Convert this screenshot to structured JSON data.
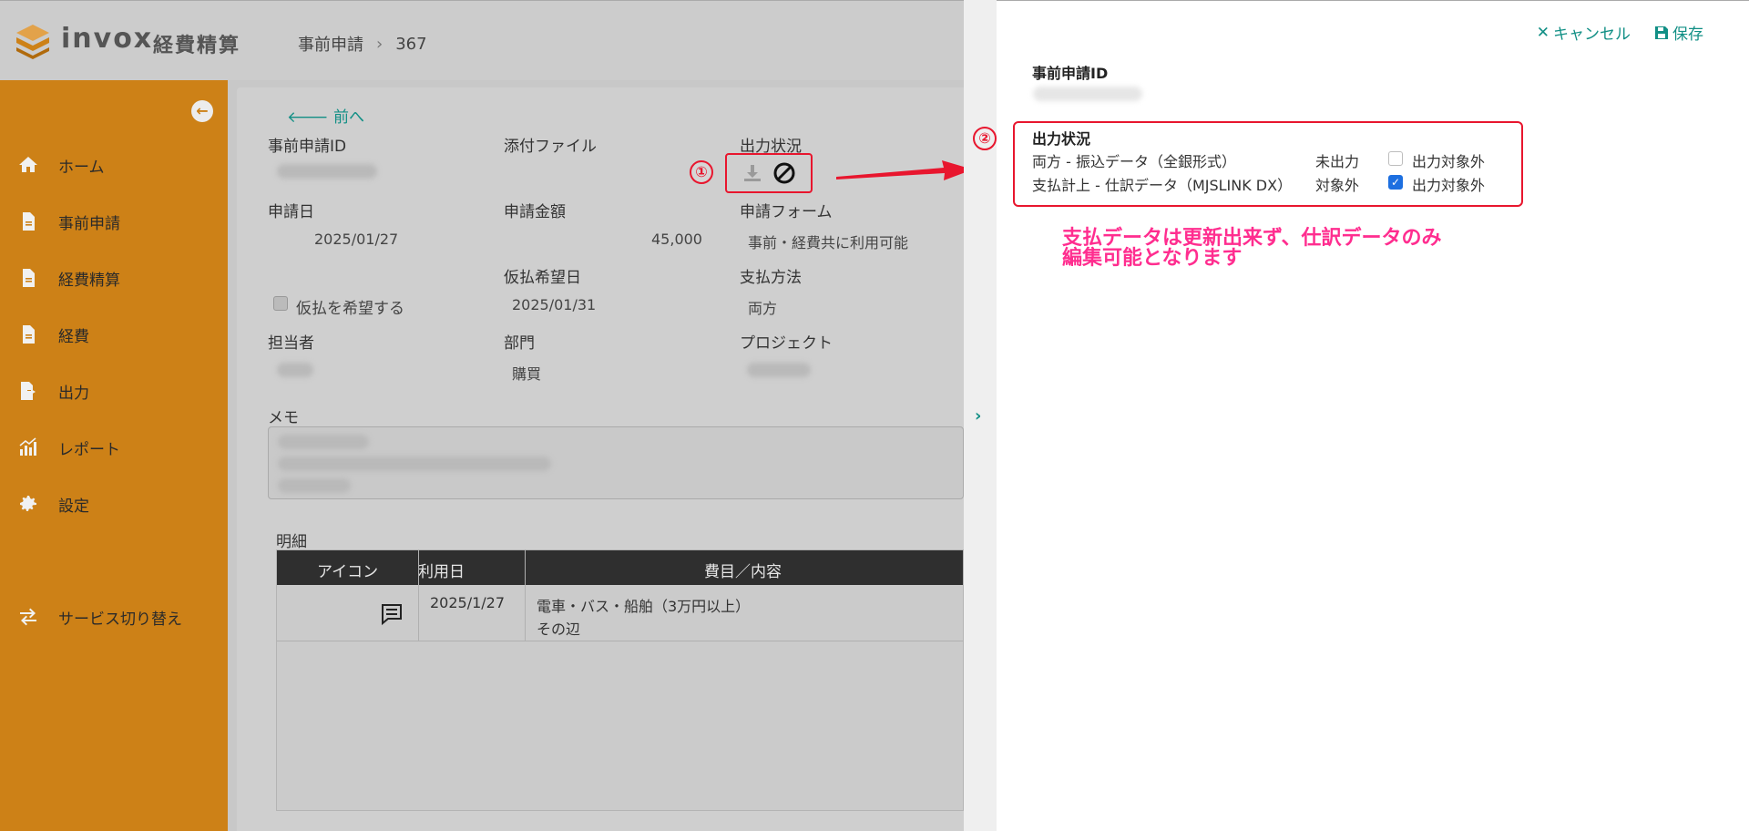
{
  "header": {
    "brand": "invox",
    "brand_sub": "経費精算",
    "breadcrumb": [
      "事前申請",
      "367"
    ]
  },
  "sidebar": {
    "items": [
      {
        "label": "ホーム",
        "icon": "home-icon"
      },
      {
        "label": "事前申請",
        "icon": "document-icon"
      },
      {
        "label": "経費精算",
        "icon": "document-icon"
      },
      {
        "label": "経費",
        "icon": "document-icon"
      },
      {
        "label": "出力",
        "icon": "export-icon"
      },
      {
        "label": "レポート",
        "icon": "chart-icon"
      },
      {
        "label": "設定",
        "icon": "gear-icon"
      }
    ],
    "switch_service": "サービス切り替え"
  },
  "main": {
    "back": "前へ",
    "fields": {
      "request_id_label": "事前申請ID",
      "attachment_label": "添付ファイル",
      "output_status_label": "出力状況",
      "apply_date_label": "申請日",
      "apply_date": "2025/01/27",
      "amount_label": "申請金額",
      "amount": "45,000",
      "form_label": "申請フォーム",
      "form": "事前・経費共に利用可能",
      "advance_date_label": "仮払希望日",
      "advance_date": "2025/01/31",
      "advance_check": "仮払を希望する",
      "payment_method_label": "支払方法",
      "payment_method": "両方",
      "person_label": "担当者",
      "dept_label": "部門",
      "dept": "購買",
      "project_label": "プロジェクト",
      "memo_label": "メモ"
    },
    "annotation_1": "①",
    "detail_label": "明細",
    "table": {
      "headers": [
        "アイコン",
        "利用日",
        "費目／内容"
      ],
      "rows": [
        {
          "date": "2025/1/27",
          "category": "電車・バス・船舶（3万円以上）",
          "content": "その辺"
        }
      ]
    }
  },
  "drawer": {
    "cancel": "キャンセル",
    "save": "保存",
    "request_id_label": "事前申請ID",
    "output_status_label": "出力状況",
    "annotation_2": "②",
    "rows": [
      {
        "name": "両方 - 振込データ（全銀形式）",
        "status": "未出力",
        "exclude_label": "出力対象外",
        "checked": false
      },
      {
        "name": "支払計上 - 仕訳データ（MJSLINK DX）",
        "status": "対象外",
        "exclude_label": "出力対象外",
        "checked": true
      }
    ],
    "note_line1": "支払データは更新出来ず、仕訳データのみ",
    "note_line2": "編集可能となります"
  },
  "colors": {
    "sidebar": "#cd8117",
    "accent": "#118f85",
    "annotation": "#e8162e",
    "note": "#ff2d8f"
  }
}
